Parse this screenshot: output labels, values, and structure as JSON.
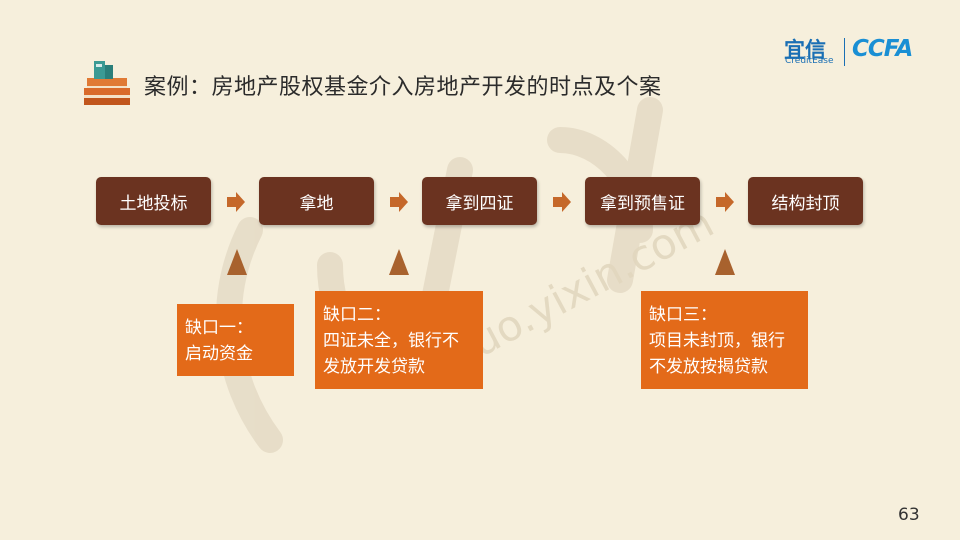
{
  "title": "案例：房地产股权基金介入房地产开发的时点及个案",
  "logo": {
    "brand": "宜信",
    "sub": "CreditEase",
    "partner": "CCFA"
  },
  "steps": [
    "土地投标",
    "拿地",
    "拿到四证",
    "拿到预售证",
    "结构封顶"
  ],
  "gaps": [
    {
      "title": "缺口一：",
      "lines": [
        "启动资金"
      ]
    },
    {
      "title": "缺口二：",
      "lines": [
        "四证未全，银行不",
        "发放开发贷款"
      ]
    },
    {
      "title": "缺口三：",
      "lines": [
        "项目未封顶，银行",
        "不发放按揭贷款"
      ]
    }
  ],
  "watermark": "zhuo.yixin.com",
  "page_number": "63",
  "colors": {
    "step": "#6b3320",
    "gap": "#e36a19",
    "arrow": "#c5682a",
    "background": "#f6efdc"
  }
}
